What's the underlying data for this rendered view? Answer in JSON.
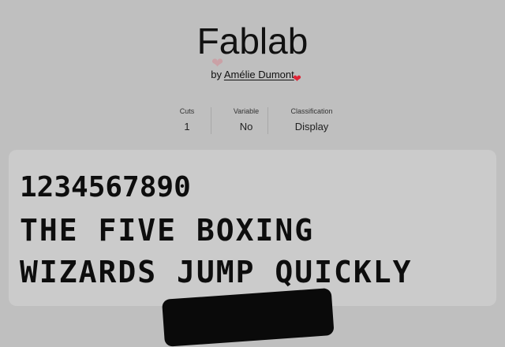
{
  "font": {
    "name": "Fablab",
    "by_prefix": "by",
    "author": "Amélie Dumont"
  },
  "stats": {
    "cuts_label": "Cuts",
    "cuts_value": "1",
    "variable_label": "Variable",
    "variable_value": "No",
    "classification_label": "Classification",
    "classification_value": "Display"
  },
  "specimen": {
    "line1": "1234567890",
    "line2": "THE FIVE BOXING",
    "line3": "WIZARDS JUMP QUICKLY"
  },
  "icons": {
    "heart_faded": "heart-icon",
    "heart_solid": "heart-icon"
  },
  "colors": {
    "background": "#bfbfbf",
    "specimen_panel": "#cbcbcb",
    "heart": "#e02436"
  }
}
